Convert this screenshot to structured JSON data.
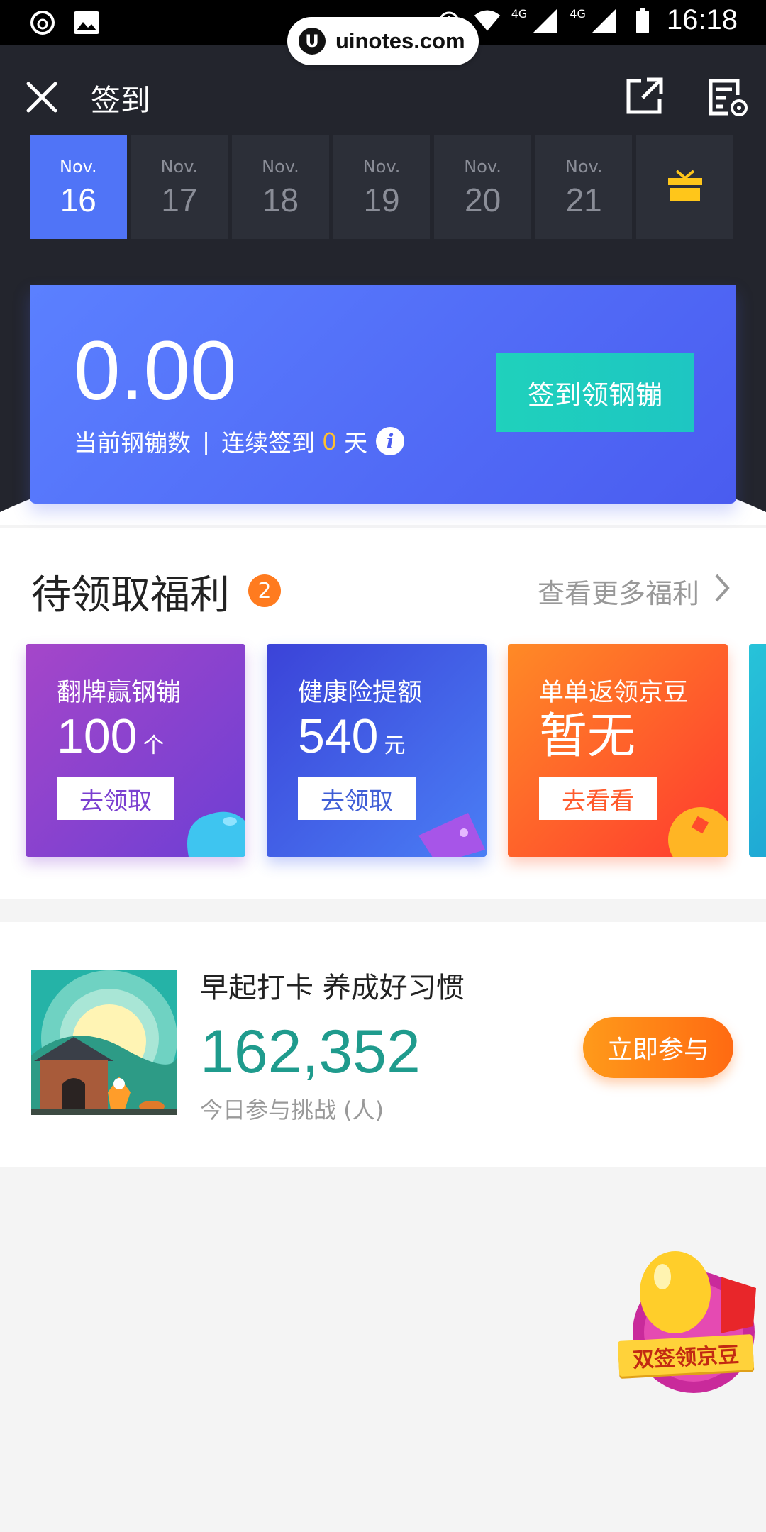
{
  "status_bar": {
    "time": "16:18",
    "net1": "4G",
    "net2": "4G"
  },
  "watermark": {
    "text": "uinotes.com",
    "logo_letter": "U"
  },
  "nav": {
    "title": "签到"
  },
  "dates": [
    {
      "month": "Nov.",
      "day": "16",
      "active": true
    },
    {
      "month": "Nov.",
      "day": "17"
    },
    {
      "month": "Nov.",
      "day": "18"
    },
    {
      "month": "Nov.",
      "day": "19"
    },
    {
      "month": "Nov.",
      "day": "20"
    },
    {
      "month": "Nov.",
      "day": "21"
    }
  ],
  "checkin": {
    "amount": "0.00",
    "label_balance": "当前钢镚数",
    "separator": "|",
    "label_streak_prefix": "连续签到",
    "streak_days": "0",
    "label_streak_suffix": "天",
    "button": "签到领钢镚"
  },
  "welfare": {
    "title": "待领取福利",
    "badge_count": "2",
    "more_label": "查看更多福利",
    "cards": [
      {
        "title": "翻牌赢钢镚",
        "value": "100",
        "unit": "个",
        "button": "去领取"
      },
      {
        "title": "健康险提额",
        "value": "540",
        "unit": "元",
        "button": "去领取"
      },
      {
        "title": "单单返领京豆",
        "value": "暂无",
        "unit": "",
        "button": "去看看"
      }
    ]
  },
  "challenge": {
    "title": "早起打卡 养成好习惯",
    "count": "162,352",
    "count_label": "今日参与挑战 (人)",
    "button": "立即参与"
  },
  "float_badge": {
    "label": "双签领京豆"
  },
  "colors": {
    "accent_blue": "#5074f7",
    "teal": "#1fd1bc",
    "orange": "#ff7b1f",
    "count_green": "#1f9b8d"
  }
}
